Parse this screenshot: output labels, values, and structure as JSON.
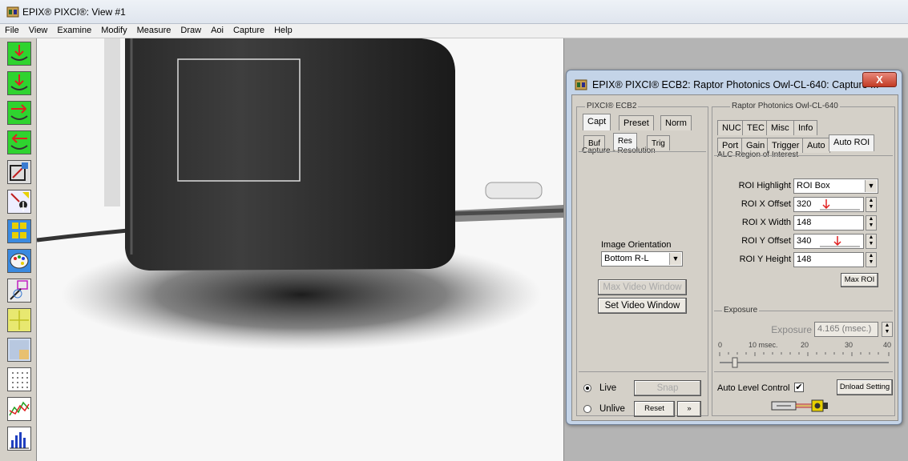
{
  "main_window": {
    "title": "EPIX® PIXCI®: View #1",
    "menu": [
      "File",
      "View",
      "Examine",
      "Modify",
      "Measure",
      "Draw",
      "Aoi",
      "Capture",
      "Help"
    ]
  },
  "toolbar_icons": [
    "capture-arrow-down-icon",
    "capture-arrow-down-icon",
    "capture-arrow-right-icon",
    "capture-arrow-left-icon",
    "image-examine-icon",
    "pixel-peek-icon",
    "snap-grid-icon",
    "palette-icon",
    "draw-icon",
    "crosshair-icon",
    "region-icon",
    "pixel-grid-icon",
    "waveform-icon",
    "histogram-icon"
  ],
  "dialog": {
    "title": "EPIX® PIXCI® ECB2: Raptor Photonics Owl-CL-640: Capture ...",
    "close_label": "X",
    "left": {
      "group_label": "PIXCI® ECB2",
      "tabs": [
        "Capt",
        "Preset",
        "Norm"
      ],
      "subtabs": [
        "Buf",
        "Res",
        "Trig"
      ],
      "section_label": "Capture - Resolution",
      "orientation_label": "Image Orientation",
      "orientation_value": "Bottom R-L",
      "max_video_window": "Max Video Window",
      "set_video_window": "Set Video Window",
      "live_label": "Live",
      "unlive_label": "Unlive",
      "snap": "Snap",
      "reset": "Reset",
      "more": "»"
    },
    "right": {
      "group_label": "Raptor Photonics Owl-CL-640",
      "tabs_row1": [
        "NUC",
        "TEC",
        "Misc",
        "Info"
      ],
      "tabs_row2": [
        "Port",
        "Gain",
        "Trigger",
        "Auto",
        "Auto ROI"
      ],
      "section_label": "ALC Region of Interest",
      "roi_highlight_label": "ROI Highlight",
      "roi_highlight_value": "ROI Box",
      "roi_x_offset_label": "ROI X Offset",
      "roi_x_offset_value": "320",
      "roi_x_width_label": "ROI X Width",
      "roi_x_width_value": "148",
      "roi_y_offset_label": "ROI Y Offset",
      "roi_y_offset_value": "340",
      "roi_y_height_label": "ROI Y Height",
      "roi_y_height_value": "148",
      "max_roi": "Max ROI",
      "exposure_group_label": "Exposure",
      "exposure_label": "Exposure",
      "exposure_value": "4.165 (msec.)",
      "scale": [
        "0",
        "10 msec.",
        "20",
        "30",
        "40"
      ],
      "auto_level_label": "Auto Level Control",
      "dnload": "Dnload Setting"
    }
  },
  "colors": {
    "toolbar_green": "#2fd32f",
    "dialog_frame": "#c4d4e8",
    "close_red": "#c23b24",
    "red_arrow": "#e02020"
  }
}
